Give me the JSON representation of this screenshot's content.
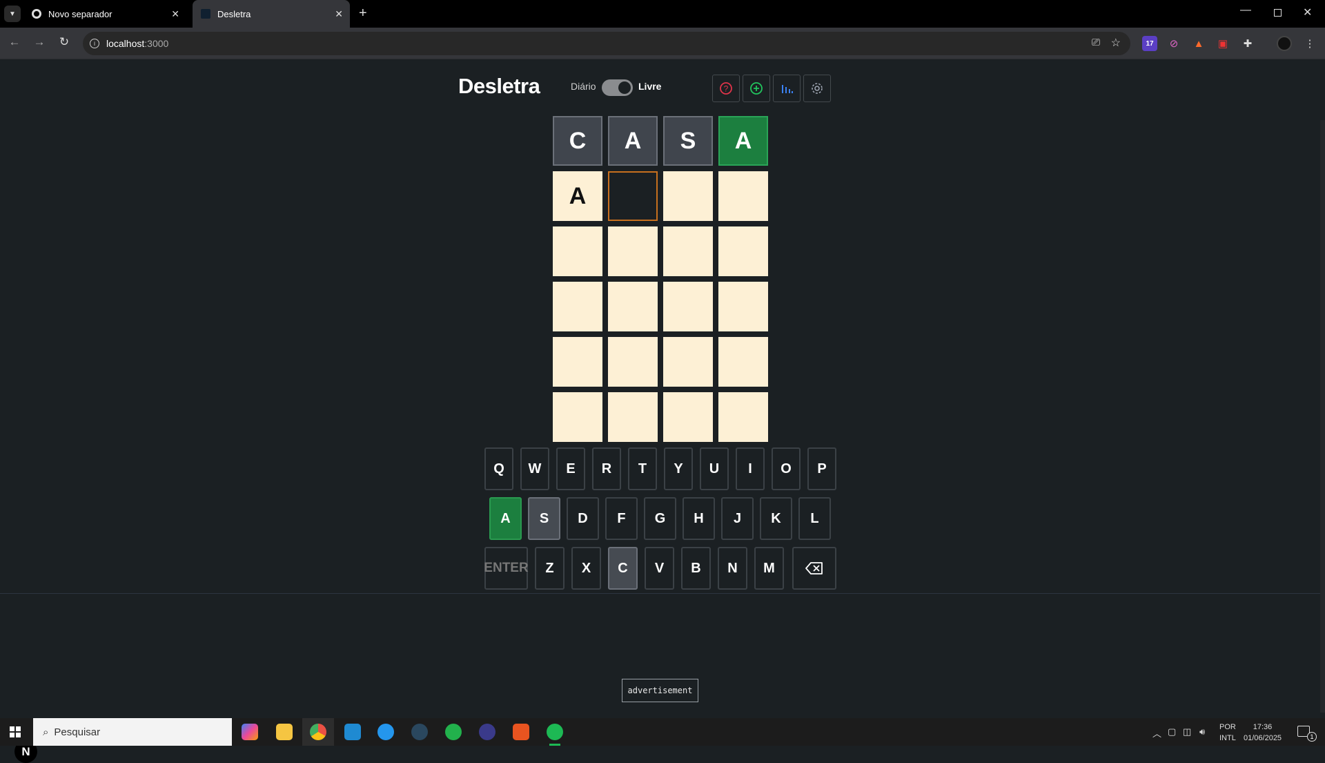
{
  "browser": {
    "tabs": [
      {
        "title": "Novo separador",
        "active": false
      },
      {
        "title": "Desletra",
        "active": true
      }
    ],
    "url": "localhost:3000",
    "url_host": "localhost",
    "url_port": ":3000",
    "extension_badge": "17"
  },
  "game": {
    "title": "Desletra",
    "mode_left": "Diário",
    "mode_right": "Livre",
    "mode_selected": "Livre",
    "header_icons": [
      "help-icon",
      "add-icon",
      "stats-icon",
      "settings-icon"
    ],
    "grid": [
      [
        {
          "l": "C",
          "s": "absent"
        },
        {
          "l": "A",
          "s": "absent"
        },
        {
          "l": "S",
          "s": "absent"
        },
        {
          "l": "A",
          "s": "correct"
        }
      ],
      [
        {
          "l": "A",
          "s": "filled"
        },
        {
          "l": "",
          "s": "active"
        },
        {
          "l": "",
          "s": "empty"
        },
        {
          "l": "",
          "s": "empty"
        }
      ],
      [
        {
          "l": "",
          "s": "empty"
        },
        {
          "l": "",
          "s": "empty"
        },
        {
          "l": "",
          "s": "empty"
        },
        {
          "l": "",
          "s": "empty"
        }
      ],
      [
        {
          "l": "",
          "s": "empty"
        },
        {
          "l": "",
          "s": "empty"
        },
        {
          "l": "",
          "s": "empty"
        },
        {
          "l": "",
          "s": "empty"
        }
      ],
      [
        {
          "l": "",
          "s": "empty"
        },
        {
          "l": "",
          "s": "empty"
        },
        {
          "l": "",
          "s": "empty"
        },
        {
          "l": "",
          "s": "empty"
        }
      ],
      [
        {
          "l": "",
          "s": "empty"
        },
        {
          "l": "",
          "s": "empty"
        },
        {
          "l": "",
          "s": "empty"
        },
        {
          "l": "",
          "s": "empty"
        }
      ]
    ],
    "keyboard": [
      [
        "Q",
        "W",
        "E",
        "R",
        "T",
        "Y",
        "U",
        "I",
        "O",
        "P"
      ],
      [
        "A",
        "S",
        "D",
        "F",
        "G",
        "H",
        "J",
        "K",
        "L"
      ],
      [
        "ENTER",
        "Z",
        "X",
        "C",
        "V",
        "B",
        "N",
        "M",
        "⌫"
      ]
    ],
    "key_states": {
      "A": "correct",
      "S": "absent",
      "C": "absent"
    },
    "advertisement": "advertisement",
    "framework_badge": "N"
  },
  "taskbar": {
    "search_placeholder": "Pesquisar",
    "language": "POR",
    "layout": "INTL",
    "time": "17:36",
    "date": "01/06/2025",
    "notifications": "1"
  },
  "colors": {
    "background": "#1b2023",
    "correct": "#1c7f3f",
    "absent": "#40454d",
    "empty_tile": "#fdf0d5",
    "active_border": "#c8701e"
  }
}
